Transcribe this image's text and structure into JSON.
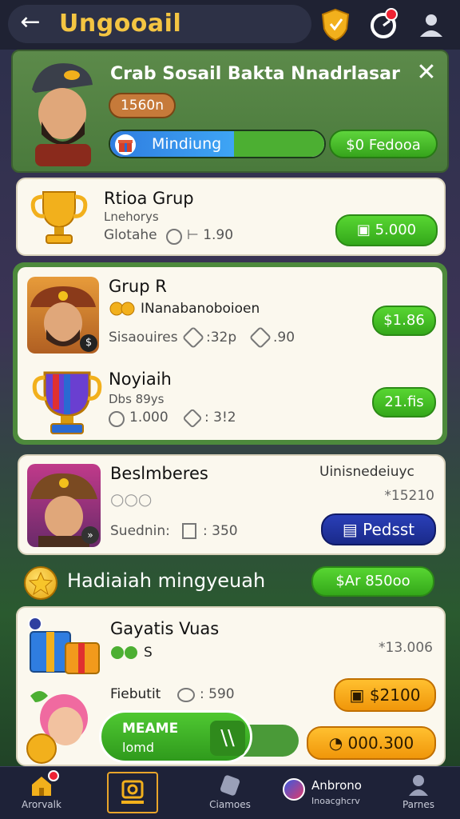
{
  "header": {
    "back_icon": "arrow-left-icon",
    "title": "Ungooail",
    "shield_icon": "shield-icon",
    "timer_icon": "timer-icon",
    "user_icon": "user-icon"
  },
  "banner": {
    "title": "Crab Sosail Bakta Nnadrlasar",
    "chip": "1560n",
    "progress_label": "Mindiung",
    "progress": 0.58,
    "action_label": "$0 Fedooa",
    "close_icon": "close-icon"
  },
  "cards": {
    "card1": {
      "title": "Rtioa Grup",
      "sub": "Lnehorys",
      "meta_label": "Glotahe",
      "meta_value": "⊢ 1.90",
      "button": "5.000"
    },
    "group": {
      "item1": {
        "title": "Grup R",
        "sub": "INanabanoboioen",
        "meta_label": "Sisaouires",
        "meta_value1": ":32p",
        "meta_value2": ".90",
        "button": "$1.86"
      },
      "item2": {
        "title": "Noyiaih",
        "sub": "Dbs 89ys",
        "meta_value1": "1.000",
        "meta_value2": ": 3!2",
        "button": "21.fis"
      }
    },
    "card4": {
      "title": "Beslmberes",
      "right_label": "Uinisnedeiuyc",
      "price": "*15210",
      "meta_label": "Suednin:",
      "meta_value": ": 350",
      "button": "Pedsst"
    }
  },
  "section": {
    "title": "Hadiaiah mingyeuah",
    "button": "$Ar 850oo"
  },
  "weekly": {
    "item1": {
      "title": "Gayatis Vuas",
      "sub": "S",
      "price": "*13.006"
    },
    "item2": {
      "meta_label": "Fiebutit",
      "meta_value": ": 590",
      "button": "$2100"
    },
    "bottom_button": "000.300"
  },
  "promo": {
    "line1": "MEAME",
    "line2": "lomd"
  },
  "nav": {
    "items": [
      {
        "label": "Arorvalk",
        "icon": "home-icon"
      },
      {
        "label": "",
        "icon": "camera-icon"
      },
      {
        "label": "Ciamoes",
        "icon": "tag-icon"
      },
      {
        "label": "Anbrono",
        "sub": "Inoacghcrv",
        "icon": "chat-icon"
      },
      {
        "label": "Parnes",
        "icon": "profile-icon"
      }
    ]
  }
}
